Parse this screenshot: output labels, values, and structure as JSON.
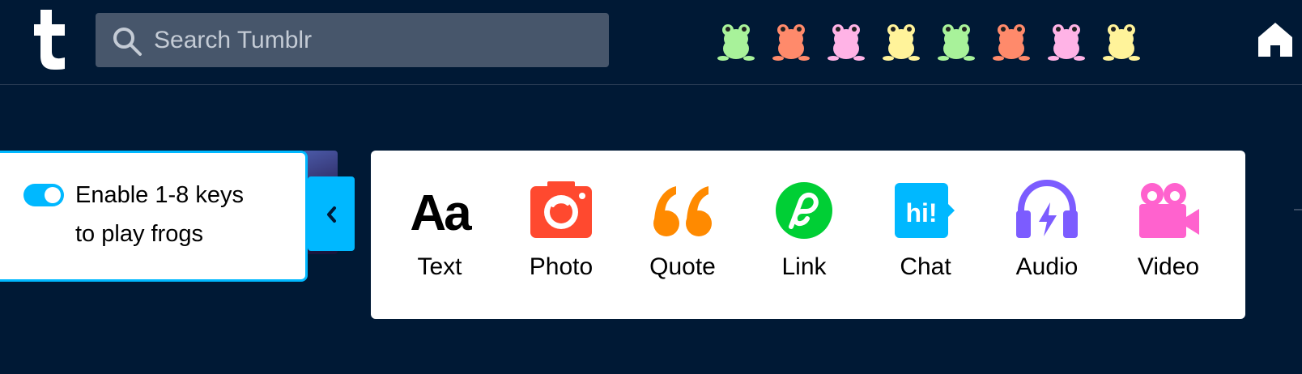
{
  "search": {
    "placeholder": "Search Tumblr",
    "value": ""
  },
  "frogs": [
    {
      "name": "frog-1",
      "color": "#a8f29a"
    },
    {
      "name": "frog-2",
      "color": "#ff8a6b"
    },
    {
      "name": "frog-3",
      "color": "#ffb3e6"
    },
    {
      "name": "frog-4",
      "color": "#fff39a"
    },
    {
      "name": "frog-5",
      "color": "#a8f29a"
    },
    {
      "name": "frog-6",
      "color": "#ff8a6b"
    },
    {
      "name": "frog-7",
      "color": "#ffb3e6"
    },
    {
      "name": "frog-8",
      "color": "#fff39a"
    }
  ],
  "toggle": {
    "enabled": true,
    "label_line1": "Enable 1-8 keys",
    "label_line2": "to play frogs"
  },
  "post_types": [
    {
      "label": "Text",
      "icon": "text-icon",
      "color": "#000000"
    },
    {
      "label": "Photo",
      "icon": "camera-icon",
      "color": "#ff492f"
    },
    {
      "label": "Quote",
      "icon": "quote-icon",
      "color": "#ff8a00"
    },
    {
      "label": "Link",
      "icon": "link-icon",
      "color": "#00cf35"
    },
    {
      "label": "Chat",
      "icon": "chat-icon",
      "color": "#00b8ff"
    },
    {
      "label": "Audio",
      "icon": "headphones-icon",
      "color": "#7c5cff"
    },
    {
      "label": "Video",
      "icon": "video-camera-icon",
      "color": "#ff62ce"
    }
  ],
  "icon_text": {
    "text": "Aa",
    "chat": "hi!"
  },
  "colors": {
    "background": "#001935",
    "accent": "#00b8ff",
    "search_bg": "#47566b"
  }
}
